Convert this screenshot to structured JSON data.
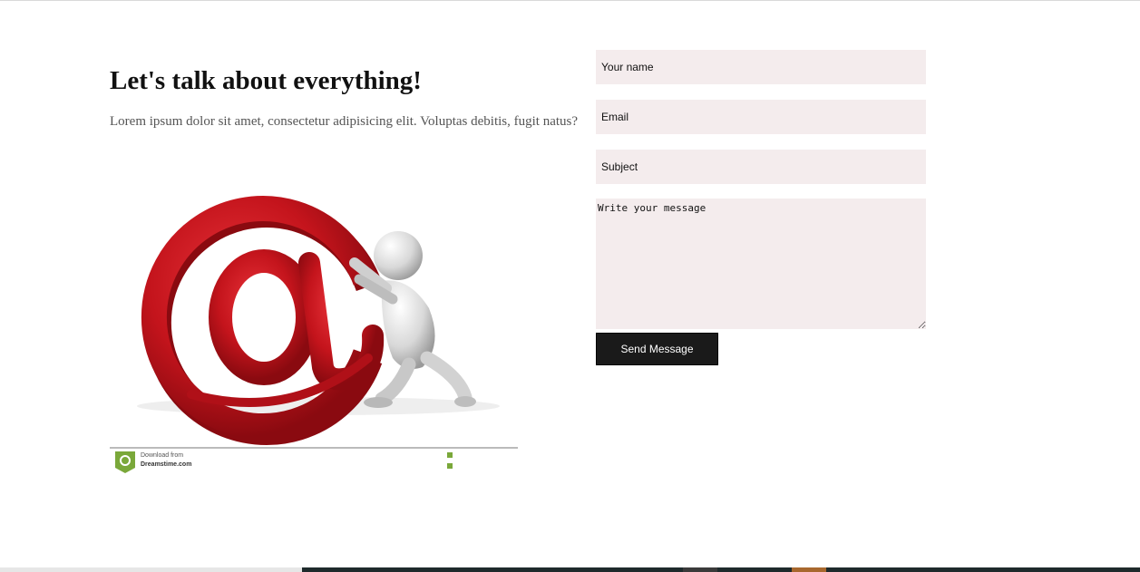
{
  "contact": {
    "heading": "Let's talk about everything!",
    "lead": "Lorem ipsum dolor sit amet, consectetur adipisicing elit. Voluptas debitis, fugit natus?"
  },
  "illustration": {
    "watermark_line1": "Download from",
    "watermark_line2": "Dreamstime.com"
  },
  "form": {
    "name_placeholder": "Your name",
    "email_placeholder": "Email",
    "subject_placeholder": "Subject",
    "message_placeholder": "Write your message",
    "send_label": "Send Message"
  },
  "colors": {
    "field_bg": "#f4eced",
    "button_bg": "#1a1a1a",
    "at_sign_red": "#c4141c"
  }
}
